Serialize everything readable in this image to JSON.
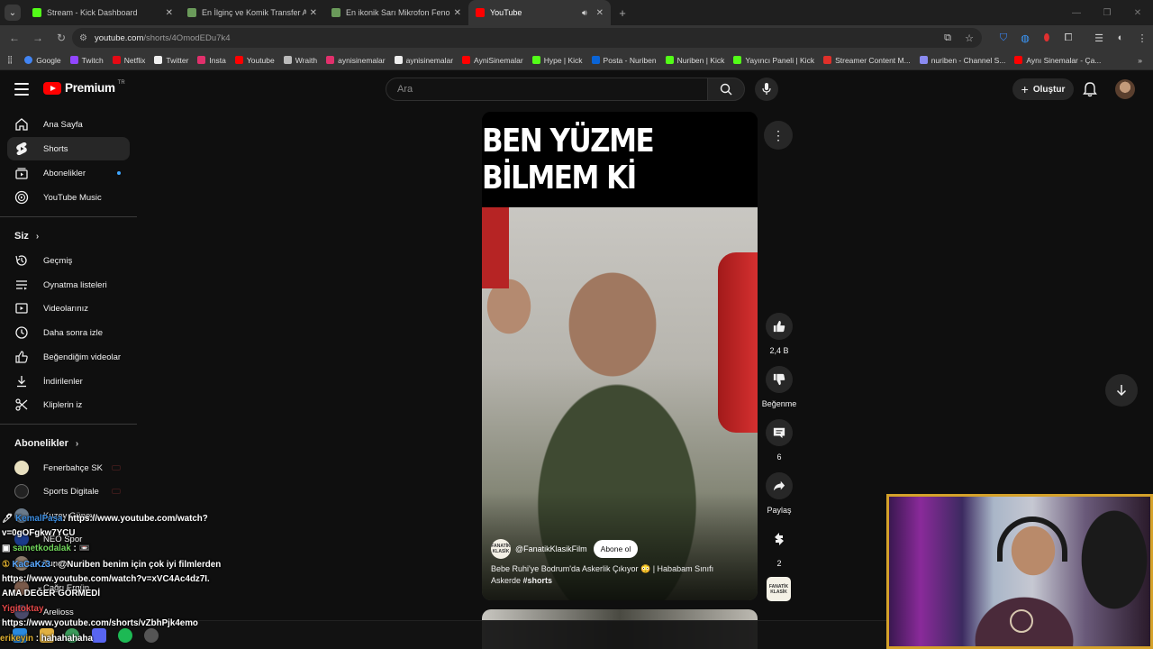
{
  "browser": {
    "tabs": [
      {
        "title": "Stream - Kick Dashboard",
        "active": false,
        "favicon_color": "#53fc18"
      },
      {
        "title": "En İlginç ve Komik Transfer Açık",
        "active": false,
        "favicon_color": "#6a9a5a"
      },
      {
        "title": "En ikonik Sarı Mikrofon Fenome",
        "active": false,
        "favicon_color": "#6a9a5a"
      },
      {
        "title": "YouTube",
        "active": true,
        "favicon_color": "#ff0000"
      }
    ],
    "url_host": "youtube.com",
    "url_path": "/shorts/4OmodEDu7k4",
    "bookmarks": [
      {
        "label": "Google",
        "icon": "google-icon",
        "color": "#4285f4"
      },
      {
        "label": "Twitch",
        "icon": "twitch-icon",
        "color": "#9146ff"
      },
      {
        "label": "Netflix",
        "icon": "netflix-icon",
        "color": "#e50914"
      },
      {
        "label": "Twitter",
        "icon": "x-icon",
        "color": "#ffffff"
      },
      {
        "label": "Insta",
        "icon": "instagram-icon",
        "color": "#e1306c"
      },
      {
        "label": "Youtube",
        "icon": "youtube-icon",
        "color": "#ff0000"
      },
      {
        "label": "Wraith",
        "icon": "wraith-icon",
        "color": "#bbbbbb"
      },
      {
        "label": "aynisinemalar",
        "icon": "instagram-icon",
        "color": "#e1306c"
      },
      {
        "label": "aynisinemalar",
        "icon": "x-icon",
        "color": "#ffffff"
      },
      {
        "label": "AyniSinemalar",
        "icon": "youtube-icon",
        "color": "#ff0000"
      },
      {
        "label": "Hype | Kick",
        "icon": "kick-icon",
        "color": "#53fc18"
      },
      {
        "label": "Posta - Nuriben",
        "icon": "outlook-icon",
        "color": "#0a64d6"
      },
      {
        "label": "Nuriben | Kick",
        "icon": "kick-icon",
        "color": "#53fc18"
      },
      {
        "label": "Yayıncı Paneli | Kick",
        "icon": "kick-icon",
        "color": "#53fc18"
      },
      {
        "label": "Streamer Content M...",
        "icon": "streamer-icon",
        "color": "#e0302a"
      },
      {
        "label": "nuriben - Channel S...",
        "icon": "channel-icon",
        "color": "#8a8af0"
      },
      {
        "label": "Aynı Sinemalar - Ça...",
        "icon": "youtube-icon",
        "color": "#ff0000"
      }
    ]
  },
  "youtube": {
    "logo_text": "Premium",
    "country_code": "TR",
    "search_placeholder": "Ara",
    "create_label": "Oluştur",
    "sidebar": {
      "main": [
        {
          "label": "Ana Sayfa",
          "icon": "home-icon"
        },
        {
          "label": "Shorts",
          "icon": "shorts-icon",
          "active": true
        },
        {
          "label": "Abonelikler",
          "icon": "subscriptions-icon",
          "dot": true
        },
        {
          "label": "YouTube Music",
          "icon": "youtube-music-icon"
        }
      ],
      "you_title": "Siz",
      "you": [
        {
          "label": "Geçmiş",
          "icon": "history-icon"
        },
        {
          "label": "Oynatma listeleri",
          "icon": "playlists-icon"
        },
        {
          "label": "Videolarınız",
          "icon": "your-videos-icon"
        },
        {
          "label": "Daha sonra izle",
          "icon": "watch-later-icon"
        },
        {
          "label": "Beğendiğim videolar",
          "icon": "liked-icon"
        },
        {
          "label": "İndirilenler",
          "icon": "downloads-icon"
        },
        {
          "label": "Kliplerin iz",
          "icon": "clips-icon"
        }
      ],
      "subs_title": "Abonelikler",
      "subs": [
        {
          "label": "Fenerbahçe SK",
          "color": "#e8e0c0"
        },
        {
          "label": "Sports Digitale",
          "color": "#222222"
        },
        {
          "label": "Kuzey Güney",
          "color": "#6a7a8a"
        },
        {
          "label": "NEO Spor",
          "color": "#1a3a8a"
        },
        {
          "label": "Tunc...",
          "color": "#8a7a6a"
        },
        {
          "label": "Çağrı Ergün",
          "color": "#7a5a4a"
        },
        {
          "label": "Arelioss",
          "color": "#4a4a6a"
        }
      ]
    },
    "short": {
      "caption": "BEN YÜZME BİLMEM Kİ",
      "channel": "@FanatikKlasikFilm",
      "channel_avatar_text": "FANATİK KLASİK",
      "subscribe_label": "Abone ol",
      "title_text": "Bebe Ruhi'ye Bodrum'da Askerlik Çıkıyor 😳 | Hababam Sınıfı Askerde",
      "hashtag": "#shorts",
      "likes": "2,4 B",
      "dislike_label": "Beğenme",
      "comments": "6",
      "share_label": "Paylaş",
      "remix_count": "2"
    }
  },
  "overlay": {
    "chat": [
      {
        "user": "KemalPaşa",
        "text": ": https://www.youtube.com/watch?",
        "cls": "u1"
      },
      {
        "user": "",
        "text": "v=0gOFgkw7YCU",
        "cls": ""
      },
      {
        "user": "sametkodalak",
        "text": " : 📼",
        "cls": "u2"
      },
      {
        "user": "KaCaKz3",
        "text": " : @Nuriben benim için çok iyi filmlerden",
        "cls": "u3"
      },
      {
        "user": "",
        "text": "https://www.youtube.com/watch?v=xVC4Ac4dz7I.",
        "cls": ""
      },
      {
        "user": "",
        "text": "AMA DEĞER GÖRMEDİ",
        "cls": ""
      },
      {
        "user": "Yigitoktay",
        "text": "",
        "cls": "u4"
      },
      {
        "user": "",
        "text": "https://www.youtube.com/shorts/vZbhPjk4emo",
        "cls": ""
      },
      {
        "user": "erikeyin",
        "text": " : hahahahaha",
        "cls": "u5"
      }
    ]
  }
}
